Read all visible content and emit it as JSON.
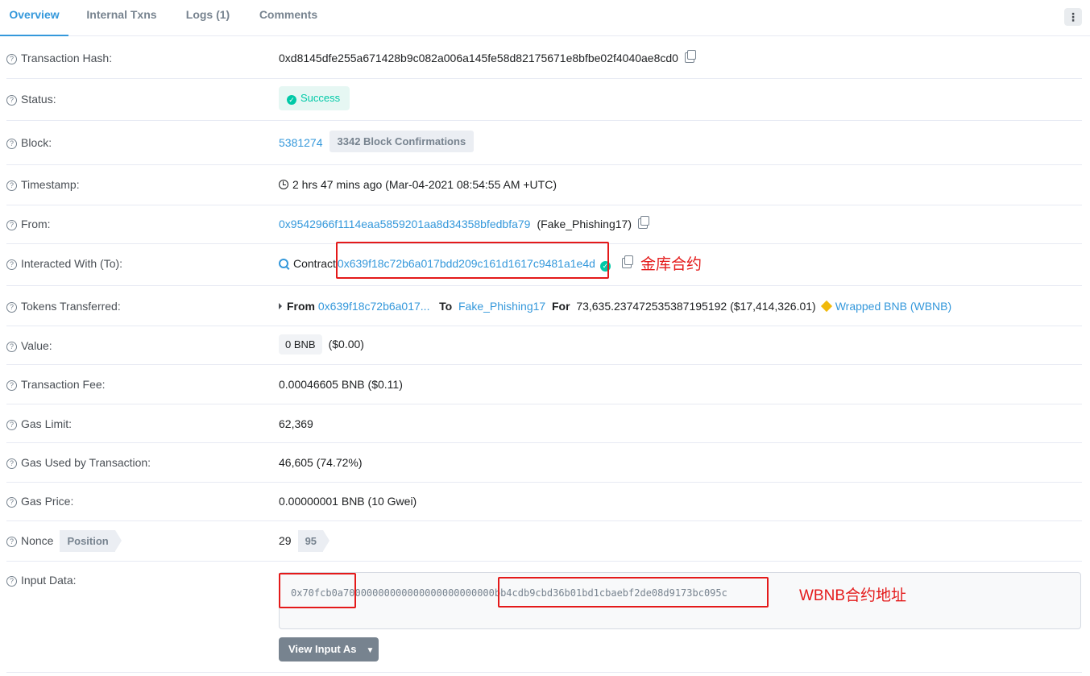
{
  "tabs": {
    "overview": "Overview",
    "internal_txns": "Internal Txns",
    "logs": "Logs (1)",
    "comments": "Comments"
  },
  "rows": {
    "tx_hash": {
      "label": "Transaction Hash:",
      "value": "0xd8145dfe255a671428b9c082a006a145fe58d82175671e8bfbe02f4040ae8cd0"
    },
    "status": {
      "label": "Status:",
      "value": "Success"
    },
    "block": {
      "label": "Block:",
      "number": "5381274",
      "confirmations": "3342 Block Confirmations"
    },
    "timestamp": {
      "label": "Timestamp:",
      "value": "2 hrs 47 mins ago (Mar-04-2021 08:54:55 AM +UTC)"
    },
    "from": {
      "label": "From:",
      "address": "0x9542966f1114eaa5859201aa8d34358bfedbfa79",
      "name": "(Fake_Phishing17)"
    },
    "interacted": {
      "label": "Interacted With (To):",
      "prefix": "Contract",
      "address": "0x639f18c72b6a017bdd209c161d1617c9481a1e4d"
    },
    "tokens": {
      "label": "Tokens Transferred:",
      "from_kw": "From",
      "from_addr": "0x639f18c72b6a017...",
      "to_kw": "To",
      "to_name": "Fake_Phishing17",
      "for_kw": "For",
      "amount": "73,635.237472535387195192 ($17,414,326.01)",
      "token": "Wrapped BNB (WBNB)"
    },
    "value": {
      "label": "Value:",
      "amount": "0 BNB",
      "usd": "($0.00)"
    },
    "fee": {
      "label": "Transaction Fee:",
      "value": "0.00046605 BNB ($0.11)"
    },
    "gas_limit": {
      "label": "Gas Limit:",
      "value": "62,369"
    },
    "gas_used": {
      "label": "Gas Used by Transaction:",
      "value": "46,605 (74.72%)"
    },
    "gas_price": {
      "label": "Gas Price:",
      "value": "0.00000001 BNB (10 Gwei)"
    },
    "nonce": {
      "label": "Nonce",
      "position_tag": "Position",
      "nonce": "29",
      "position": "95"
    },
    "input": {
      "label": "Input Data:",
      "value": "0x70fcb0a70000000000000000000000000bb4cdb9cbd36b01bd1cbaebf2de08d9173bc095c",
      "button": "View Input As"
    }
  },
  "annotations": {
    "vault_contract": "金库合约",
    "wbnb_address": "WBNB合约地址"
  },
  "colors": {
    "link": "#3498db",
    "success": "#00c9a7",
    "annotation": "#e41a1a",
    "bnb": "#f0b90b"
  },
  "icons": [
    "question-icon",
    "copy-icon",
    "check-circle-icon",
    "clock-icon",
    "search-icon",
    "verified-icon",
    "caret-right-icon",
    "bnb-icon",
    "chevron-down-icon",
    "more-vertical-icon"
  ]
}
